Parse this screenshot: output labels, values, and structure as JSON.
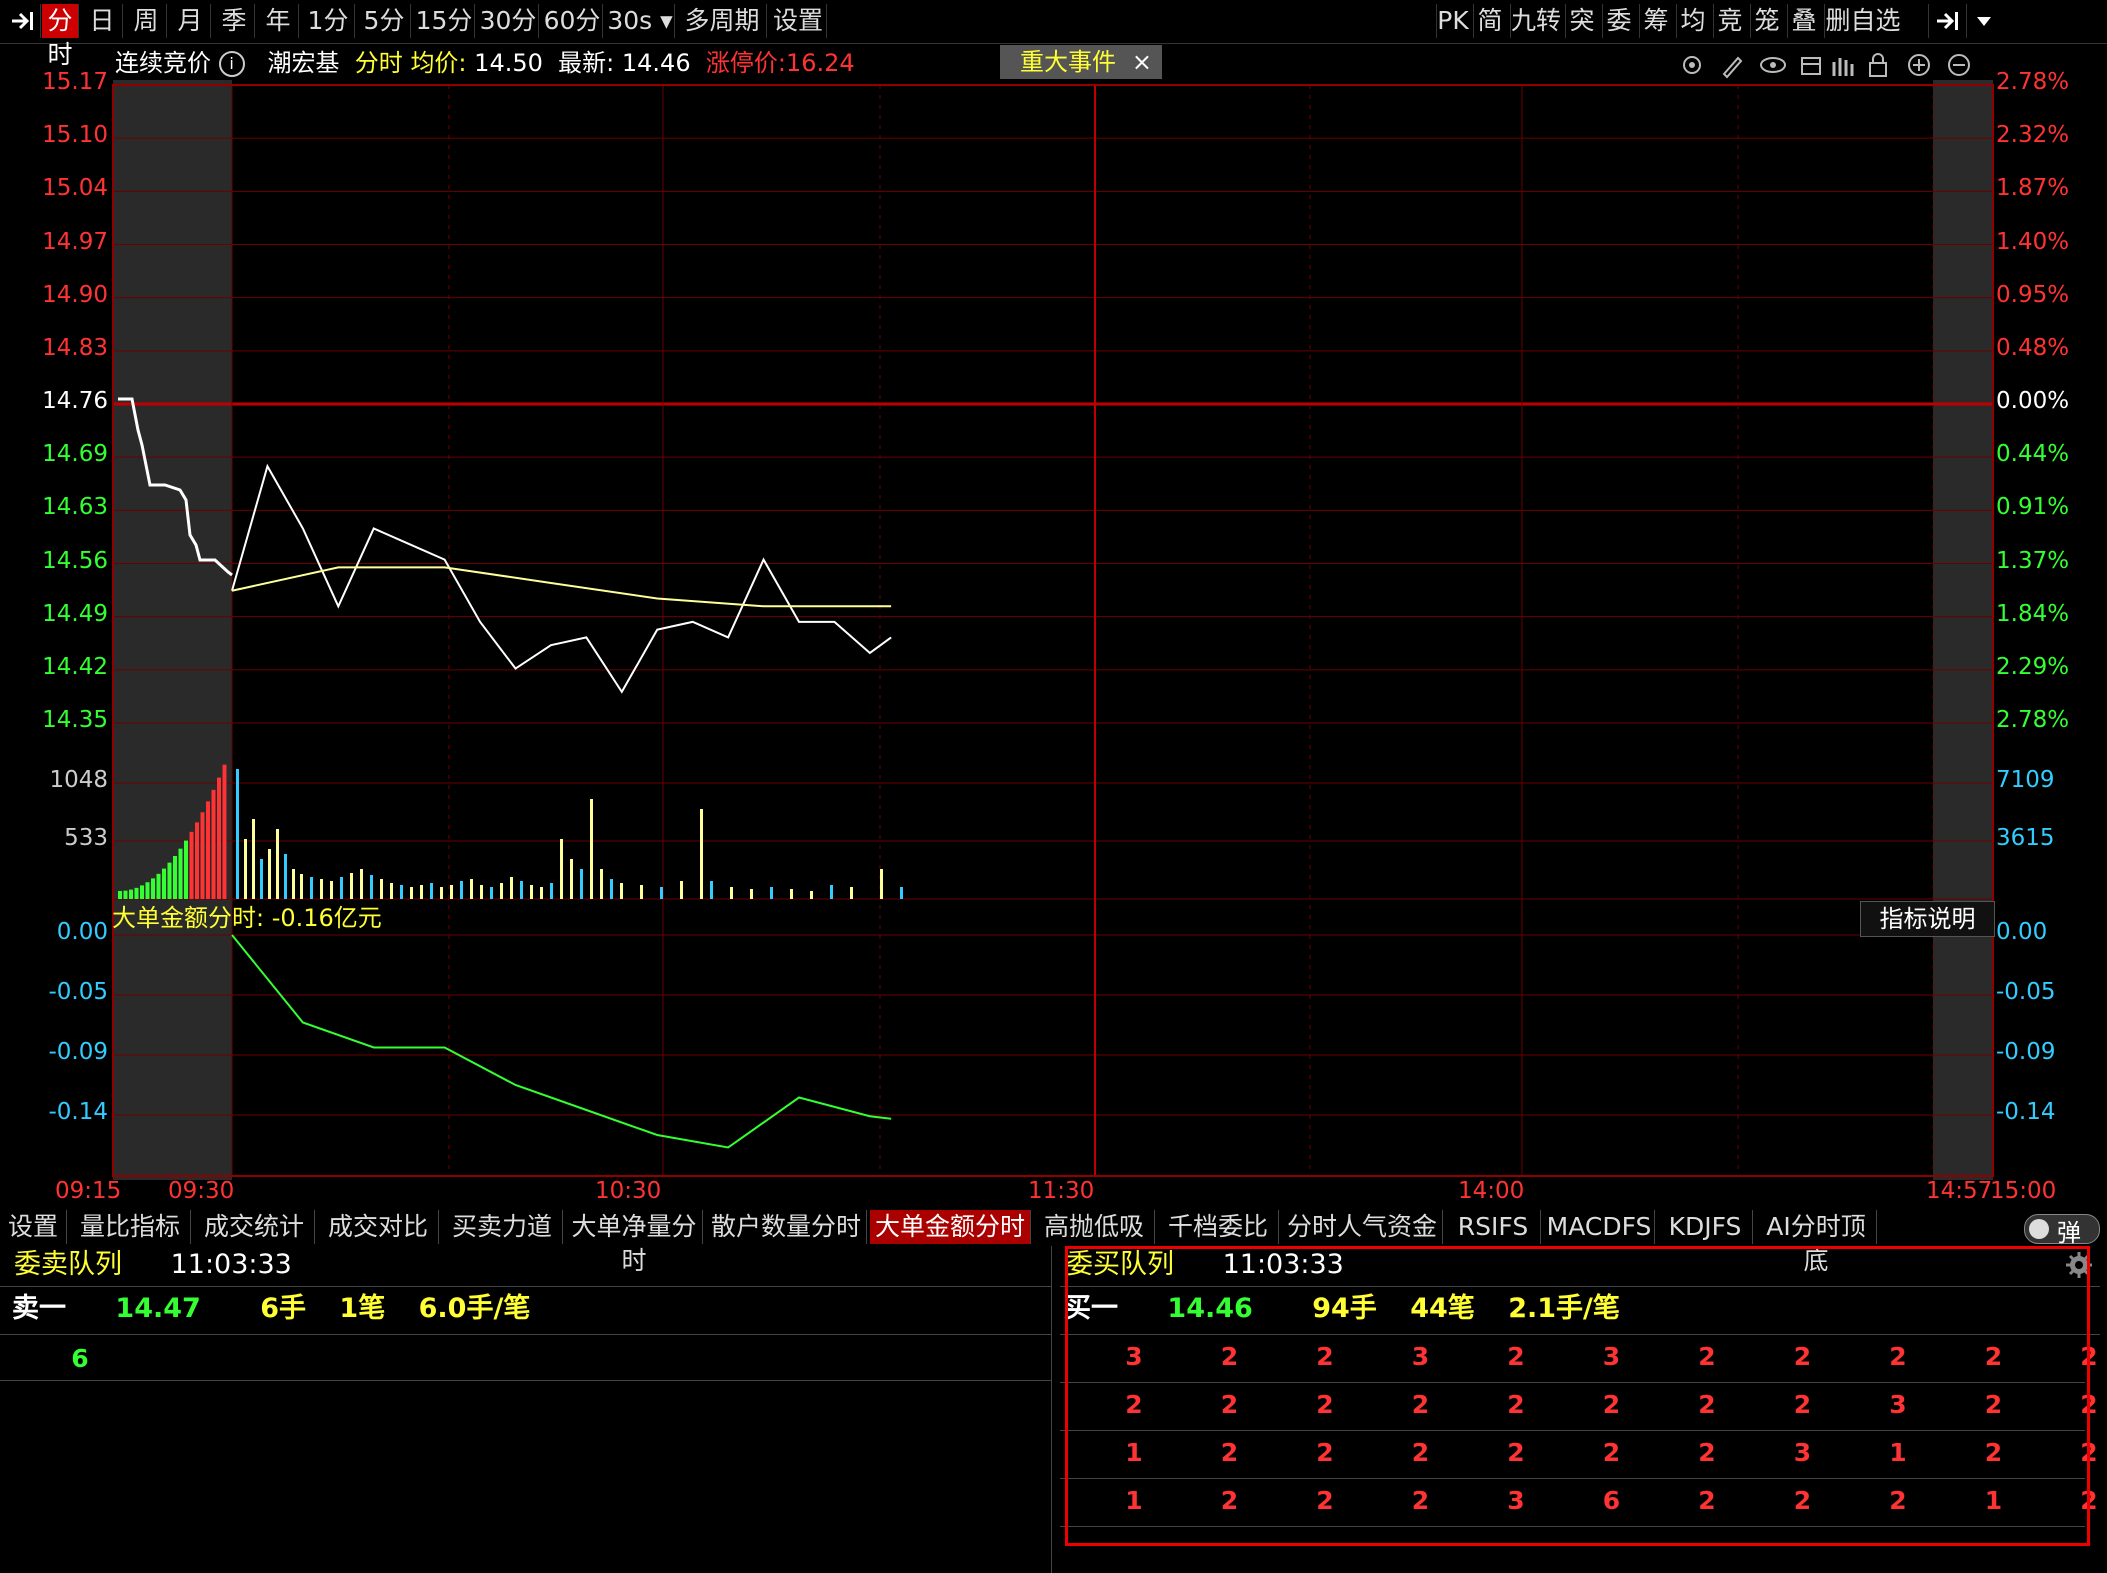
{
  "toolbar": {
    "left_tabs": [
      "分时",
      "日",
      "周",
      "月",
      "季",
      "年",
      "1分",
      "5分",
      "15分",
      "30分",
      "60分",
      "30s",
      "多周期",
      "设置"
    ],
    "right_tabs": [
      "PK",
      "简",
      "九转",
      "突",
      "委",
      "筹",
      "均",
      "竞",
      "笼",
      "叠",
      "删自选"
    ]
  },
  "info": {
    "auction_label": "连续竞价",
    "stock_name": "潮宏基",
    "mode": "分时",
    "avg_label": "均价:",
    "avg_value": "14.50",
    "last_label": "最新:",
    "last_value": "14.46",
    "limit_label": "涨停价:",
    "limit_value": "16.24",
    "event_tab": "重大事件",
    "event_close": "×"
  },
  "price_axis": {
    "left": [
      "15.17",
      "15.10",
      "15.04",
      "14.97",
      "14.90",
      "14.83",
      "14.76",
      "14.69",
      "14.63",
      "14.56",
      "14.49",
      "14.42",
      "14.35"
    ],
    "right": [
      "2.78%",
      "2.32%",
      "1.87%",
      "1.40%",
      "0.95%",
      "0.48%",
      "0.00%",
      "0.44%",
      "0.91%",
      "1.37%",
      "1.84%",
      "2.29%",
      "2.78%"
    ]
  },
  "volume_axis": {
    "left": [
      "1048",
      "533"
    ],
    "right": [
      "7109",
      "3615"
    ]
  },
  "indicator": {
    "title": "大单金额分时: -0.16亿元",
    "explain_button": "指标说明",
    "left": [
      "0.00",
      "-0.05",
      "-0.09",
      "-0.14"
    ],
    "right": [
      "0.00",
      "-0.05",
      "-0.09",
      "-0.14"
    ]
  },
  "time_axis": [
    "09:15",
    "09:30",
    "10:30",
    "11:30",
    "14:00",
    "14:57",
    "15:00"
  ],
  "bottom_tabs": [
    "设置",
    "量比指标",
    "成交统计",
    "成交对比",
    "买卖力道",
    "大单净量分时",
    "散户数量分时",
    "大单金额分时",
    "高抛低吸",
    "千档委比",
    "分时人气资金",
    "RSIFS",
    "MACDFS",
    "KDJFS",
    "AI分时顶底"
  ],
  "toggle_label": "弹",
  "sell_queue": {
    "title": "委卖队列",
    "time": "11:03:33",
    "level": "卖一",
    "price": "14.47",
    "hands": "6手",
    "orders": "1笔",
    "avg": "6.0手/笔",
    "items": [
      "6"
    ]
  },
  "buy_queue": {
    "title": "委买队列",
    "time": "11:03:33",
    "level": "买一",
    "price": "14.46",
    "hands": "94手",
    "orders": "44笔",
    "avg": "2.1手/笔",
    "rows": [
      [
        "3",
        "2",
        "2",
        "3",
        "2",
        "3",
        "2",
        "2",
        "2",
        "2",
        "2"
      ],
      [
        "2",
        "2",
        "2",
        "2",
        "2",
        "2",
        "2",
        "2",
        "3",
        "2",
        "2"
      ],
      [
        "1",
        "2",
        "2",
        "2",
        "2",
        "2",
        "2",
        "3",
        "1",
        "2",
        "2"
      ],
      [
        "1",
        "2",
        "2",
        "2",
        "3",
        "6",
        "2",
        "2",
        "2",
        "1",
        "2"
      ]
    ]
  },
  "chart_data": [
    {
      "type": "line",
      "title": "",
      "series": [
        {
          "name": "",
          "x": [
            "09:30",
            "09:35",
            "09:40",
            "09:45",
            "09:50",
            "09:55",
            "10:00",
            "10:05",
            "10:10",
            "10:15",
            "10:20",
            "10:25",
            "10:30",
            "10:35",
            "10:40",
            "10:45",
            "10:50",
            "10:55",
            "11:00",
            "11:03"
          ],
          "values": [
            14.52,
            14.68,
            14.6,
            14.5,
            14.6,
            14.58,
            14.56,
            14.48,
            14.42,
            14.45,
            14.46,
            14.39,
            14.47,
            14.48,
            14.46,
            14.56,
            14.48,
            14.48,
            14.44,
            14.46
          ]
        },
        {
          "name": "均价",
          "x": [
            "09:30",
            "09:45",
            "10:00",
            "10:15",
            "10:30",
            "10:45",
            "11:00",
            "11:03"
          ],
          "values": [
            14.52,
            14.55,
            14.55,
            14.53,
            14.51,
            14.5,
            14.5,
            14.5
          ]
        }
      ],
      "ylim": [
        14.35,
        15.17
      ]
    },
    {
      "type": "line",
      "title": "大单金额分时",
      "series": [
        {
          "name": "",
          "x": [
            "09:30",
            "09:40",
            "09:50",
            "10:00",
            "10:10",
            "10:20",
            "10:30",
            "10:40",
            "10:50",
            "11:00",
            "11:03"
          ],
          "values": [
            0.0,
            -0.07,
            -0.09,
            -0.09,
            -0.12,
            -0.14,
            -0.16,
            -0.17,
            -0.13,
            -0.145,
            -0.147
          ]
        }
      ],
      "ylim": [
        -0.16,
        0.0
      ]
    }
  ]
}
